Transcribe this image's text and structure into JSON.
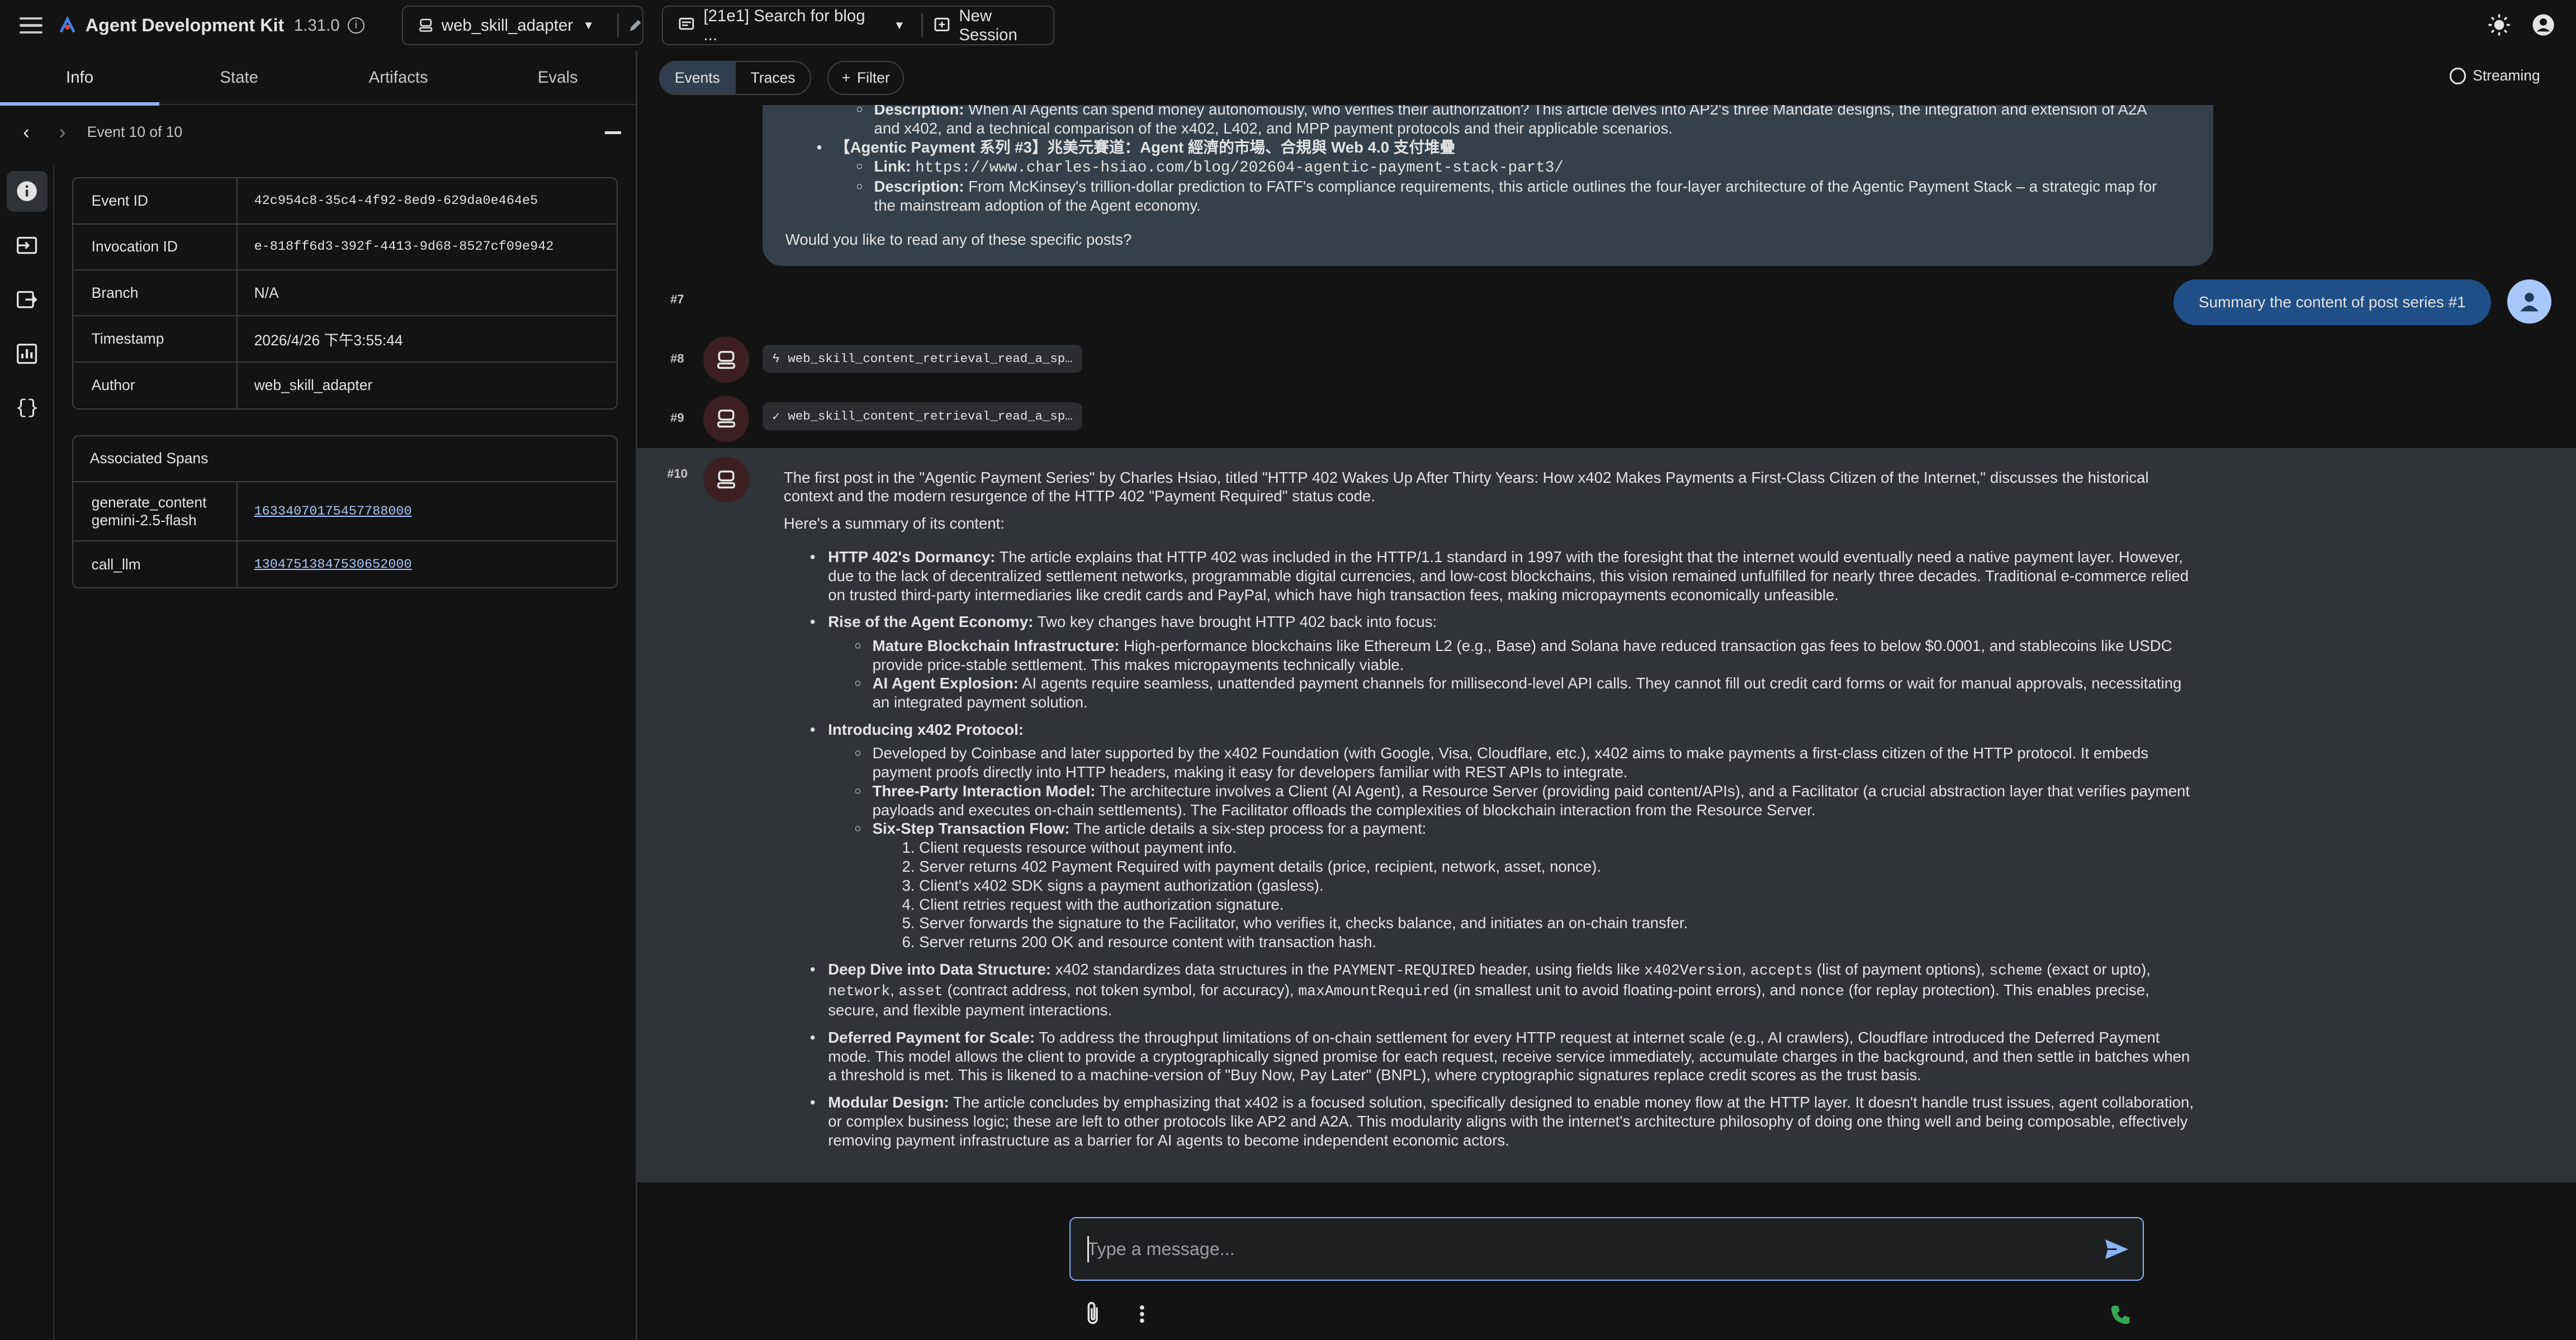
{
  "header": {
    "app_title": "Agent Development Kit",
    "version": "1.31.0",
    "agent": "web_skill_adapter",
    "session": "[21e1] Search for blog ...",
    "new_session": "New Session"
  },
  "left_tabs": [
    "Info",
    "State",
    "Artifacts",
    "Evals"
  ],
  "event_nav": {
    "label": "Event 10 of 10"
  },
  "event_info": {
    "rows": [
      {
        "key": "Event ID",
        "value": "42c954c8-35c4-4f92-8ed9-629da0e464e5"
      },
      {
        "key": "Invocation ID",
        "value": "e-818ff6d3-392f-4413-9d68-8527cf09e942"
      },
      {
        "key": "Branch",
        "value": "N/A"
      },
      {
        "key": "Timestamp",
        "value": "2026/4/26 下午3:55:44"
      },
      {
        "key": "Author",
        "value": "web_skill_adapter"
      }
    ]
  },
  "associated_spans": {
    "title": "Associated Spans",
    "rows": [
      {
        "name_line1": "generate_content",
        "name_line2": "gemini-2.5-flash",
        "id": "16334070175457788000"
      },
      {
        "name_line1": "call_llm",
        "name_line2": "",
        "id": "13047513847530652000"
      }
    ]
  },
  "view_toggle": {
    "events": "Events",
    "traces": "Traces"
  },
  "filter_label": "Filter",
  "streaming_label": "Streaming",
  "prev_message": {
    "desc1_label": "Description:",
    "desc1_line1": "When AI Agents can spend money autonomously, who verifies their authorization? This article delves into AP2's three Mandate designs, the integration and extension of A2A",
    "desc1_line2": "and x402, and a technical comparison of the x402, L402, and MPP payment protocols and their applicable scenarios.",
    "series3_title": "【Agentic Payment 系列 #3】兆美元賽道：Agent 經濟的市場、合規與 Web 4.0 支付堆疊",
    "link_label": "Link:",
    "link_url": "https://www.charles-hsiao.com/blog/202604-agentic-payment-stack-part3/",
    "desc2_label": "Description:",
    "desc2_line1": "From McKinsey's trillion-dollar prediction to FATF's compliance requirements, this article outlines the four-layer architecture of the Agentic Payment Stack – a strategic map for",
    "desc2_line2": "the mainstream adoption of the Agent economy.",
    "question": "Would you like to read any of these specific posts?"
  },
  "events": {
    "e7": "#7",
    "e8": "#8",
    "e9": "#9",
    "e10": "#10",
    "user_message": "Summary the content of post series #1",
    "tool_call": "web_skill_content_retrieval_read_a_sp…",
    "tool_response": "web_skill_content_retrieval_read_a_sp…"
  },
  "response": {
    "intro1": "The first post in the \"Agentic Payment Series\" by Charles Hsiao, titled \"HTTP 402 Wakes Up After Thirty Years: How x402 Makes Payments a First-Class Citizen of the Internet,\" discusses the historical",
    "intro2": "context and the modern resurgence of the HTTP 402 \"Payment Required\" status code.",
    "summary_intro": "Here's a summary of its content:",
    "dormancy_title": "HTTP 402's Dormancy:",
    "dormancy_text": "The article explains that HTTP 402 was included in the HTTP/1.1 standard in 1997 with the foresight that the internet would eventually need a native payment layer. However, due to the lack of decentralized settlement networks, programmable digital currencies, and low-cost blockchains, this vision remained unfulfilled for nearly three decades. Traditional e-commerce relied on trusted third-party intermediaries like credit cards and PayPal, which have high transaction fees, making micropayments economically unfeasible.",
    "rise_title": "Rise of the Agent Economy:",
    "rise_text": "Two key changes have brought HTTP 402 back into focus:",
    "rise_sub1_title": "Mature Blockchain Infrastructure:",
    "rise_sub1_text": "High-performance blockchains like Ethereum L2 (e.g., Base) and Solana have reduced transaction gas fees to below $0.0001, and stablecoins like USDC provide price-stable settlement. This makes micropayments technically viable.",
    "rise_sub2_title": "AI Agent Explosion:",
    "rise_sub2_text": "AI agents require seamless, unattended payment channels for millisecond-level API calls. They cannot fill out credit card forms or wait for manual approvals, necessitating an integrated payment solution.",
    "intro_x402_title": "Introducing x402 Protocol:",
    "x402_sub1_text": "Developed by Coinbase and later supported by the x402 Foundation (with Google, Visa, Cloudflare, etc.), x402 aims to make payments a first-class citizen of the HTTP protocol. It embeds payment proofs directly into HTTP headers, making it easy for developers familiar with REST APIs to integrate.",
    "x402_sub2_title": "Three-Party Interaction Model:",
    "x402_sub2_text": "The architecture involves a Client (AI Agent), a Resource Server (providing paid content/APIs), and a Facilitator (a crucial abstraction layer that verifies payment payloads and executes on-chain settlements). The Facilitator offloads the complexities of blockchain interaction from the Resource Server.",
    "x402_sub3_title": "Six-Step Transaction Flow:",
    "x402_sub3_text": "The article details a six-step process for a payment:",
    "steps": [
      "1. Client requests resource without payment info.",
      "2. Server returns 402 Payment Required with payment details (price, recipient, network, asset, nonce).",
      "3. Client's x402 SDK signs a payment authorization (gasless).",
      "4. Client retries request with the authorization signature.",
      "5. Server forwards the signature to the Facilitator, who verifies it, checks balance, and initiates an on-chain transfer.",
      "6. Server returns 200 OK and resource content with transaction hash."
    ],
    "deep_title": "Deep Dive into Data Structure:",
    "deep_t1": "x402 standardizes data structures in the",
    "deep_c1": "PAYMENT-REQUIRED",
    "deep_t2": "header, using fields like",
    "deep_c2": "x402Version",
    "deep_c3": "accepts",
    "deep_t3": "(list of payment options),",
    "deep_c4": "scheme",
    "deep_t4": "(exact or upto),",
    "deep_c5": "network",
    "deep_c6": "asset",
    "deep_t5": "(contract address, not token symbol, for accuracy),",
    "deep_c7": "maxAmountRequired",
    "deep_t6": "(in smallest unit to avoid floating-point errors), and",
    "deep_c8": "nonce",
    "deep_t7": "(for replay protection). This enables precise, secure, and flexible payment interactions.",
    "deferred_title": "Deferred Payment for Scale:",
    "deferred_text": "To address the throughput limitations of on-chain settlement for every HTTP request at internet scale (e.g., AI crawlers), Cloudflare introduced the Deferred Payment mode. This model allows the client to provide a cryptographically signed promise for each request, receive service immediately, accumulate charges in the background, and then settle in batches when a threshold is met. This is likened to a machine-version of \"Buy Now, Pay Later\" (BNPL), where cryptographic signatures replace credit scores as the trust basis.",
    "modular_title": "Modular Design:",
    "modular_text": "The article concludes by emphasizing that x402 is a focused solution, specifically designed to enable money flow at the HTTP layer. It doesn't handle trust issues, agent collaboration, or complex business logic; these are left to other protocols like AP2 and A2A. This modularity aligns with the internet's architecture philosophy of doing one thing well and being composable, effectively removing payment infrastructure as a barrier for AI agents to become independent economic actors."
  },
  "composer": {
    "placeholder": "Type a message..."
  },
  "colors": {
    "accent": "#8ab4f8",
    "user_bubble": "#1f4f86",
    "call_green": "#34a853"
  }
}
